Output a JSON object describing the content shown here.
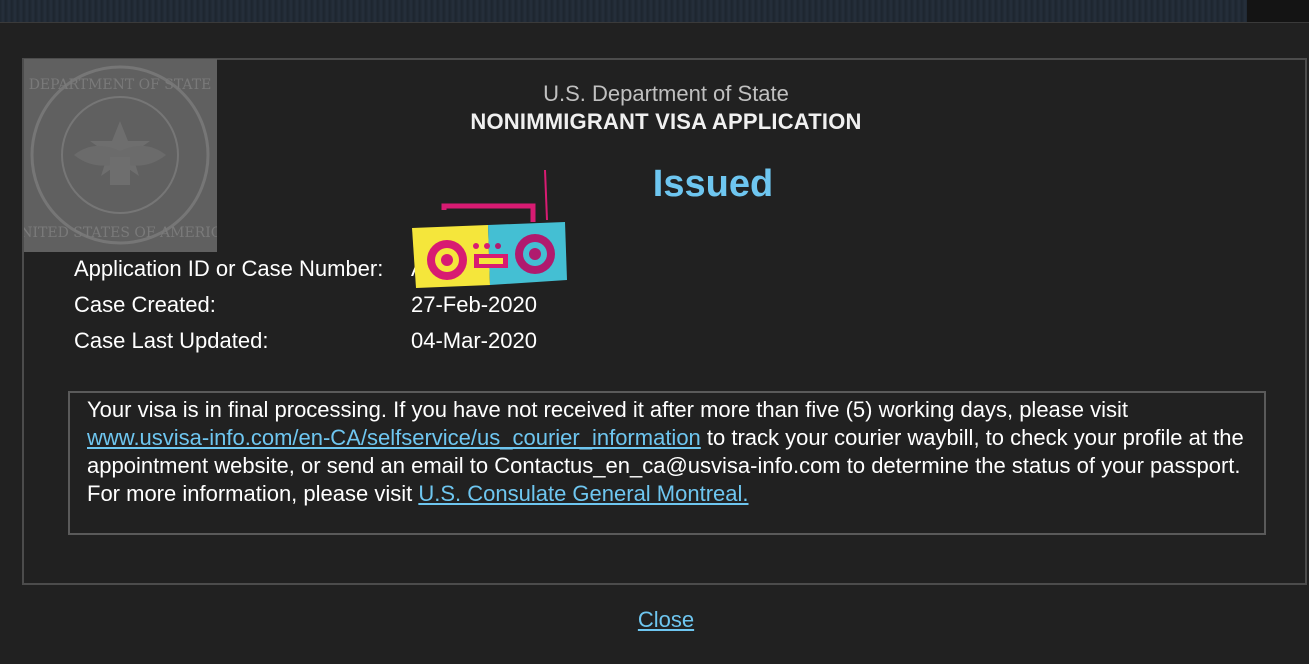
{
  "header": {
    "department": "U.S. Department of State",
    "form_title": "NONIMMIGRANT VISA APPLICATION"
  },
  "status": {
    "label": "Issued",
    "color": "#6ec6f0"
  },
  "case_info": {
    "application_id_label": "Application ID or Case Number:",
    "application_id_value": "A",
    "created_label": "Case Created:",
    "created_value": "27-Feb-2020",
    "updated_label": "Case Last Updated:",
    "updated_value": "04-Mar-2020"
  },
  "message": {
    "text_1": "Your visa is in final processing. If you have not received it after more than five (5) working days, please visit",
    "link_1": "www.usvisa-info.com/en-CA/selfservice/us_courier_information",
    "text_2": " to track your courier waybill, to check your profile at the appointment website, or send an email to Contactus_en_ca@usvisa-info.com to determine the status of your passport.",
    "text_3": "For more information, please visit ",
    "link_2": "U.S. Consulate General Montreal."
  },
  "footer": {
    "close_label": "Close"
  },
  "icons": {
    "seal": "department-of-state-seal",
    "sticker": "boombox-sticker"
  }
}
